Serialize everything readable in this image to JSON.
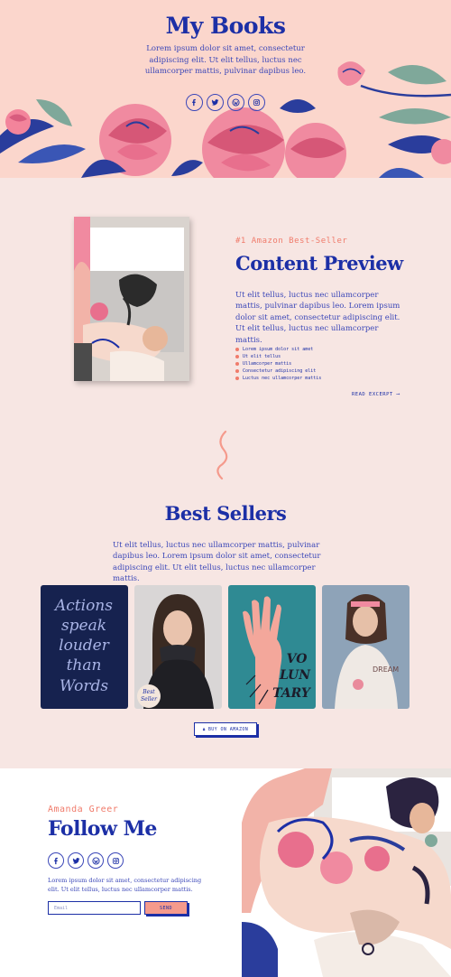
{
  "hero": {
    "title": "My Books",
    "description": "Lorem ipsum dolor sit amet, consectetur adipiscing elit. Ut elit tellus, luctus nec ullamcorper mattis, pulvinar dapibus leo.",
    "socials": [
      "facebook-icon",
      "twitter-icon",
      "wordpress-icon",
      "instagram-icon"
    ]
  },
  "preview": {
    "eyebrow": "#1 Amazon Best-Seller",
    "title": "Content Preview",
    "description": "Ut elit tellus, luctus nec ullamcorper mattis, pulvinar dapibus leo. Lorem ipsum dolor sit amet, consectetur adipiscing elit. Ut elit tellus, luctus nec ullamcorper mattis.",
    "list": [
      "Lorem ipsum dolor sit amet",
      "Ut elit tellus",
      "Ullamcorper mattis",
      "Consectetur adipiscing elit",
      "Luctus nec ullamcorper mattis"
    ],
    "read_link": "READ EXCERPT"
  },
  "best_sellers": {
    "title": "Best Sellers",
    "description": "Ut elit tellus, luctus nec ullamcorper mattis, pulvinar dapibus leo. Lorem ipsum dolor sit amet, consectetur adipiscing elit. Ut elit tellus, luctus nec ullamcorper mattis.",
    "books": [
      {
        "cover_text": [
          "Actions",
          "speak",
          "louder",
          "than",
          "Words"
        ]
      },
      {
        "cover_text": [
          "Best",
          "Seller"
        ]
      },
      {
        "cover_text": [
          "VO",
          "LUN",
          "TARY"
        ]
      },
      {
        "cover_text": [
          "DREAM"
        ]
      }
    ],
    "buy_label": "BUY ON AMAZON"
  },
  "follow": {
    "eyebrow": "Amanda Greer",
    "title": "Follow Me",
    "description": "Lorem ipsum dolor sit amet, consectetur adipiscing elit. Ut elit tellus, luctus nec ullamcorper mattis.",
    "email_placeholder": "Email",
    "send_label": "SEND"
  },
  "colors": {
    "primary": "#1c2fa6",
    "accent": "#f07b6b",
    "hero_bg": "#fbd6cc",
    "page_bg": "#f7e6e3"
  }
}
